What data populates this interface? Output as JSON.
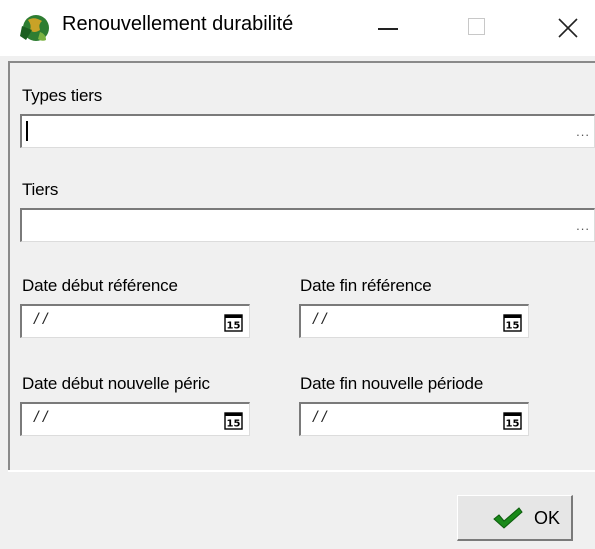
{
  "window": {
    "title": "Renouvellement durabilité",
    "icons": {
      "app": "app-globe-icon",
      "minimize": "minimize-icon",
      "maximize": "maximize-icon",
      "close": "close-icon"
    }
  },
  "form": {
    "types_tiers": {
      "label": "Types tiers",
      "value": "",
      "button": "..."
    },
    "tiers": {
      "label": "Tiers",
      "value": "",
      "button": "..."
    },
    "date_debut_reference": {
      "label": "Date début référence",
      "value": "/ /"
    },
    "date_fin_reference": {
      "label": "Date fin référence",
      "value": "/ /"
    },
    "date_debut_nouvelle_periode": {
      "label": "Date début nouvelle péric",
      "value": "/ /"
    },
    "date_fin_nouvelle_periode": {
      "label": "Date fin nouvelle période",
      "value": "/ /"
    },
    "calendar_icon": "calendar-icon"
  },
  "footer": {
    "ok_label": "OK",
    "ok_icon": "checkmark-icon"
  },
  "colors": {
    "dialog_bg": "#f0f0f0",
    "check_green": "#1a8a1a"
  }
}
